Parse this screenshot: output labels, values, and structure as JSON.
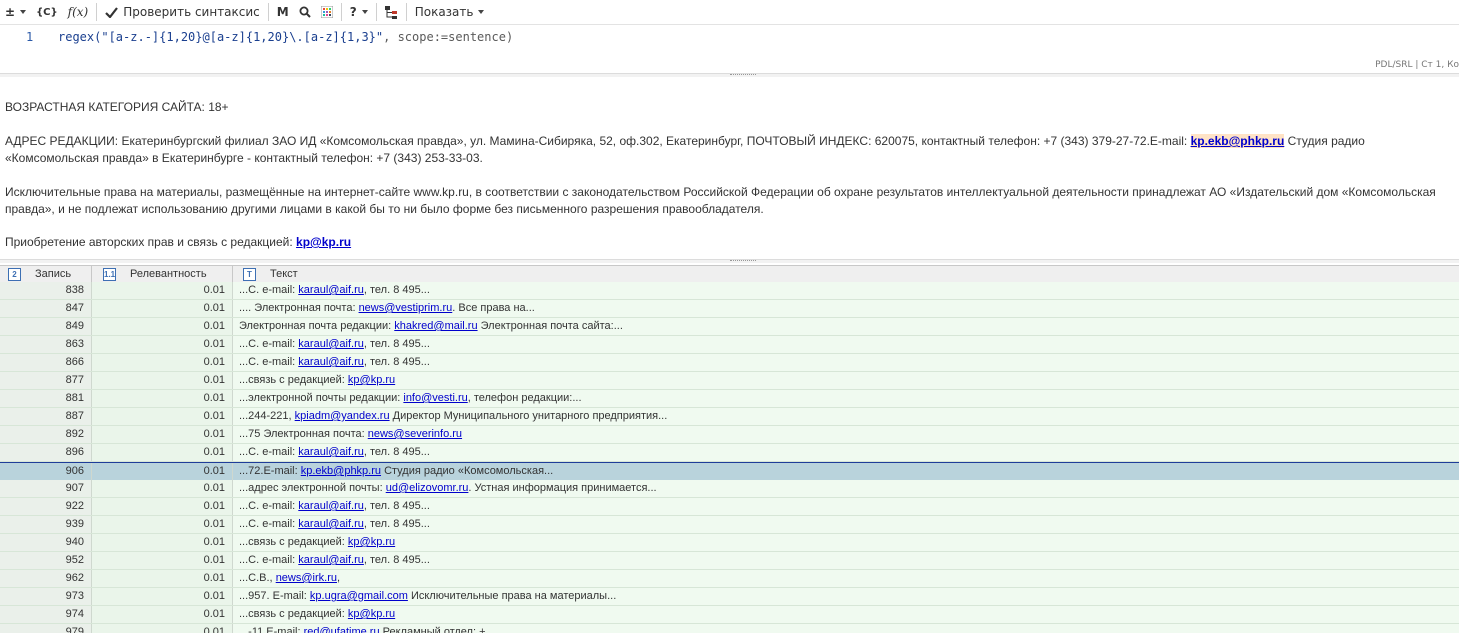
{
  "toolbar": {
    "btn_pm": "±",
    "btn_c": "{C}",
    "btn_fx": "f(x)",
    "check_label": "Проверить синтаксис",
    "btn_m": "M",
    "btn_help": "?",
    "show_label": "Показать"
  },
  "editor": {
    "line_number": "1",
    "code_fn": "regex(",
    "code_str": "\"[a-z.-]{1,20}@[a-z]{1,20}\\.[a-z]{1,3}\"",
    "code_rest": ", scope:=sentence)",
    "status": "PDL/SRL | Ст 1, Ко"
  },
  "document": {
    "p1": "ВОЗРАСТНАЯ КАТЕГОРИЯ САЙТА: 18+",
    "p2_before": "АДРЕС РЕДАКЦИИ: Екатеринбургский филиал ЗАО ИД «Комсомольская правда», ул. Мамина-Сибиряка, 52, оф.302, Екатеринбург, ПОЧТОВЫЙ ИНДЕКС: 620075, контактный телефон: +7 (343) 379-27-72.E-mail: ",
    "p2_link": "kp.ekb@phkp.ru",
    "p2_after": " Студия радио «Комсомольская правда» в Екатеринбурге - контактный телефон: +7 (343) 253-33-03.",
    "p3": "Исключительные права на материалы, размещённые на интернет-сайте www.kp.ru, в соответствии с законодательством Российской Федерации об охране результатов интеллектуальной деятельности принадлежат АО «Издательский дом «Комсомольская правда», и не подлежат использованию другими лицами в какой бы то ни было форме без письменного разрешения правообладателя.",
    "p4_before": "Приобретение авторских прав и связь с редакцией: ",
    "p4_link": "kp@kp.ru"
  },
  "grid": {
    "columns": [
      {
        "badge": "2",
        "label": "Запись"
      },
      {
        "badge": "1.1",
        "label": "Релевантность"
      },
      {
        "badge": "T",
        "label": "Текст"
      }
    ],
    "rows": [
      {
        "record": "838",
        "rel": "0.01",
        "pre": "...С. e-mail: ",
        "link": "karaul@aif.ru",
        "post": ", тел. 8 495..."
      },
      {
        "record": "847",
        "rel": "0.01",
        "pre": ".... Электронная почта: ",
        "link": "news@vestiprim.ru",
        "post": ". Все права на..."
      },
      {
        "record": "849",
        "rel": "0.01",
        "pre": "Электронная почта редакции: ",
        "link": "khakred@mail.ru",
        "post": " Электронная почта сайта:..."
      },
      {
        "record": "863",
        "rel": "0.01",
        "pre": "...С. e-mail: ",
        "link": "karaul@aif.ru",
        "post": ", тел. 8 495..."
      },
      {
        "record": "866",
        "rel": "0.01",
        "pre": "...С. e-mail: ",
        "link": "karaul@aif.ru",
        "post": ", тел. 8 495..."
      },
      {
        "record": "877",
        "rel": "0.01",
        "pre": "...связь с редакцией: ",
        "link": "kp@kp.ru",
        "post": ""
      },
      {
        "record": "881",
        "rel": "0.01",
        "pre": "...электронной почты редакции: ",
        "link": "info@vesti.ru",
        "post": ", телефон редакции:..."
      },
      {
        "record": "887",
        "rel": "0.01",
        "pre": "...244-221, ",
        "link": "kpiadm@yandex.ru",
        "post": " Директор Муниципального унитарного предприятия..."
      },
      {
        "record": "892",
        "rel": "0.01",
        "pre": "...75 Электронная почта: ",
        "link": "news@severinfo.ru",
        "post": ""
      },
      {
        "record": "896",
        "rel": "0.01",
        "pre": "...С. e-mail: ",
        "link": "karaul@aif.ru",
        "post": ", тел. 8 495..."
      },
      {
        "record": "906",
        "rel": "0.01",
        "pre": "...72.E-mail: ",
        "link": "kp.ekb@phkp.ru",
        "post": " Студия радио «Комсомольская..."
      },
      {
        "record": "907",
        "rel": "0.01",
        "pre": "...адрес электронной почты: ",
        "link": "ud@elizovomr.ru",
        "post": ". Устная информация принимается..."
      },
      {
        "record": "922",
        "rel": "0.01",
        "pre": "...С. e-mail: ",
        "link": "karaul@aif.ru",
        "post": ", тел. 8 495..."
      },
      {
        "record": "939",
        "rel": "0.01",
        "pre": "...С. e-mail: ",
        "link": "karaul@aif.ru",
        "post": ", тел. 8 495..."
      },
      {
        "record": "940",
        "rel": "0.01",
        "pre": "...связь с редакцией: ",
        "link": "kp@kp.ru",
        "post": ""
      },
      {
        "record": "952",
        "rel": "0.01",
        "pre": "...С. e-mail: ",
        "link": "karaul@aif.ru",
        "post": ", тел. 8 495..."
      },
      {
        "record": "962",
        "rel": "0.01",
        "pre": "...С.В., ",
        "link": "news@irk.ru",
        "post": ","
      },
      {
        "record": "973",
        "rel": "0.01",
        "pre": "...957. E-mail: ",
        "link": "kp.ugra@gmail.com",
        "post": " Исключительные права на материалы..."
      },
      {
        "record": "974",
        "rel": "0.01",
        "pre": "...связь с редакцией: ",
        "link": "kp@kp.ru",
        "post": ""
      },
      {
        "record": "979",
        "rel": "0.01",
        "pre": "...-11 E-mail: ",
        "link": "red@ufatime.ru",
        "post": " Рекламный отдел: +"
      }
    ]
  }
}
